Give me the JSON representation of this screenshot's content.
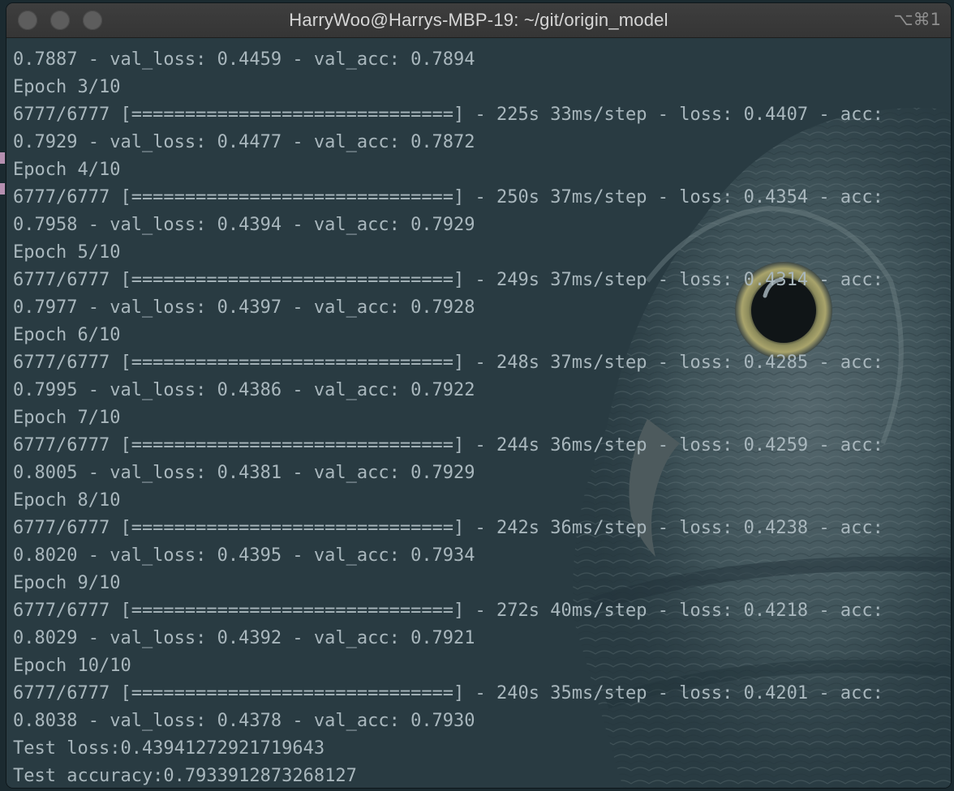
{
  "window": {
    "title": "HarryWoo@Harrys-MBP-19: ~/git/origin_model",
    "shortcut": "⌥⌘1"
  },
  "terminal": {
    "lines": [
      "0.7887 - val_loss: 0.4459 - val_acc: 0.7894",
      "Epoch 3/10",
      "6777/6777 [==============================] - 225s 33ms/step - loss: 0.4407 - acc:",
      "0.7929 - val_loss: 0.4477 - val_acc: 0.7872",
      "Epoch 4/10",
      "6777/6777 [==============================] - 250s 37ms/step - loss: 0.4354 - acc:",
      "0.7958 - val_loss: 0.4394 - val_acc: 0.7929",
      "Epoch 5/10",
      "6777/6777 [==============================] - 249s 37ms/step - loss: 0.4314 - acc:",
      "0.7977 - val_loss: 0.4397 - val_acc: 0.7928",
      "Epoch 6/10",
      "6777/6777 [==============================] - 248s 37ms/step - loss: 0.4285 - acc:",
      "0.7995 - val_loss: 0.4386 - val_acc: 0.7922",
      "Epoch 7/10",
      "6777/6777 [==============================] - 244s 36ms/step - loss: 0.4259 - acc:",
      "0.8005 - val_loss: 0.4381 - val_acc: 0.7929",
      "Epoch 8/10",
      "6777/6777 [==============================] - 242s 36ms/step - loss: 0.4238 - acc:",
      "0.8020 - val_loss: 0.4395 - val_acc: 0.7934",
      "Epoch 9/10",
      "6777/6777 [==============================] - 272s 40ms/step - loss: 0.4218 - acc:",
      "0.8029 - val_loss: 0.4392 - val_acc: 0.7921",
      "Epoch 10/10",
      "6777/6777 [==============================] - 240s 35ms/step - loss: 0.4201 - acc:",
      "0.8038 - val_loss: 0.4378 - val_acc: 0.7930",
      "Test loss:0.43941272921719643",
      "Test accuracy:0.7933912873268127"
    ]
  },
  "colors": {
    "background": "#293b42",
    "text": "#a9b7bd",
    "titlebar": "#3a3a3a"
  },
  "icons": {
    "background_image": "owl-background"
  }
}
